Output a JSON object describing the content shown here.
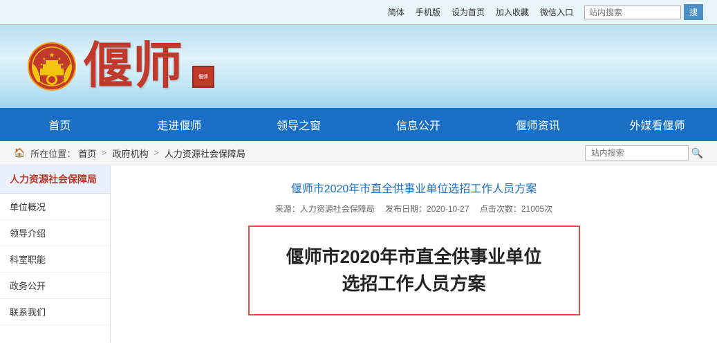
{
  "topbar": {
    "links": [
      "简体",
      "手机版",
      "设为首页",
      "加入收藏",
      "微信入口"
    ],
    "search_placeholder": "站内搜索",
    "search_btn": "搜"
  },
  "header": {
    "site_name": "偃师",
    "seal_text": "偃师"
  },
  "nav": {
    "items": [
      "首页",
      "走进偃师",
      "领导之窗",
      "信息公开",
      "偃师资讯",
      "外媒看偃师"
    ]
  },
  "breadcrumb": {
    "home": "首页",
    "separator1": ">",
    "level1": "政府机构",
    "separator2": ">",
    "level2": "人力资源社会保障局",
    "search_placeholder": "站内搜索"
  },
  "sidebar": {
    "title": "人力资源社会保障局",
    "items": [
      "单位概况",
      "领导介绍",
      "科室职能",
      "政务公开",
      "联系我们"
    ]
  },
  "article": {
    "title": "偃师市2020年市直全供事业单位选招工作人员方案",
    "source": "来源：人力资源社会保障局",
    "date": "发布日期：2020-10-27",
    "views": "点击次数：21005次",
    "big_title_line1": "偃师市2020年市直全供事业单位",
    "big_title_line2": "选招工作人员方案"
  }
}
